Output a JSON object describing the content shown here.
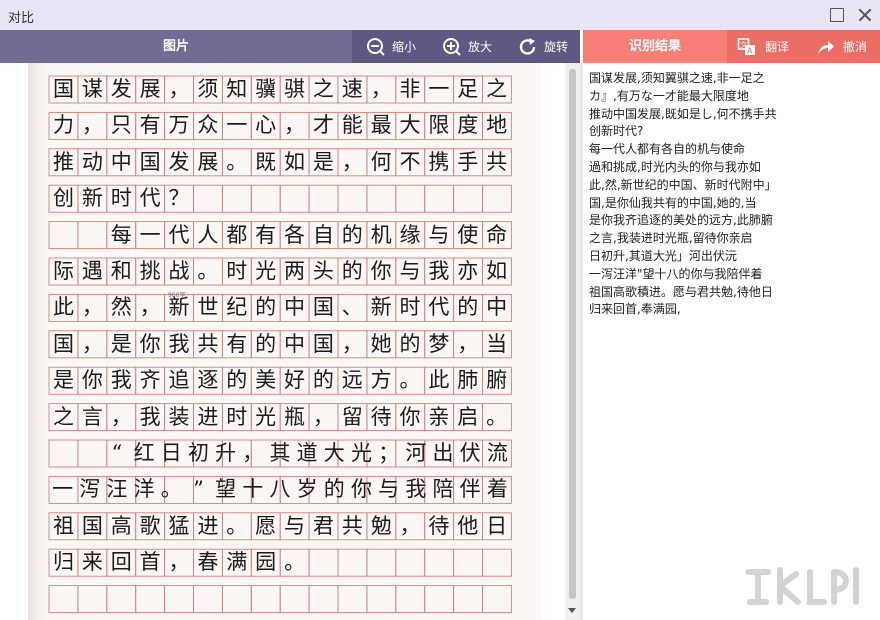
{
  "window": {
    "title": "对比"
  },
  "left_panel": {
    "title": "图片",
    "tools": [
      {
        "label": "缩小",
        "icon": "zoom-out-icon"
      },
      {
        "label": "放大",
        "icon": "zoom-in-icon"
      },
      {
        "label": "旋转",
        "icon": "rotate-icon"
      }
    ],
    "handwriting_rows": [
      "国谋发展，须知骥骐之速，非一足之",
      "力，只有万众一心，才能最大限度地",
      "推动中国发展。既如是，何不携手共",
      "创新时代？",
      "  每一代人都有各自的机缘与使命",
      "际遇和挑战。时光两头的你与我亦如",
      "此，然，新世纪的中国、新时代的中",
      "国，是你我共有的中国，她的梦，当",
      "是你我齐追逐的美好的远方。此肺腑",
      "之言，我装进时光瓶，留待你亲启。",
      "  “红日初升，其道大光；河出伏流",
      "一泻汪洋。”望十八岁的你与我陪伴着",
      "祖国高歌猛进。愿与君共勉，待他日",
      "归来回首，春满园。"
    ],
    "small_note": "960字"
  },
  "right_panel": {
    "title": "识别结果",
    "tools": [
      {
        "label": "翻译",
        "icon": "translate-icon"
      },
      {
        "label": "撤消",
        "icon": "undo-icon"
      }
    ],
    "result_lines": [
      "国谋发展,须知翼骐之速,非一足之",
      "カ』,有万な一才能最大限度地",
      "推动中国发展,既如是し,何不携手共",
      "创新时代?",
      "每一代人都有各自的机与使命",
      "過和挑成,时光内头的你与我亦如",
      "此,然,新世纪的中国、新时代附中」",
      "国,是你仙我共有的中国,她的,当",
      "是你我齐追逐的美处的远方,此肺腑",
      "之言,我装进时光瓶,留待你亲启",
      "日初升,其道大光」河出伏沅",
      "一泻汪洋\"望十八的你与我陪伴着",
      "祖国高歌積进。愿与君共勉,待他日",
      "归来回首,奉满园,"
    ]
  },
  "colors": {
    "left_bar": "#746b94",
    "left_tools_bg": "#5f5882",
    "right_bar": "#f47a73",
    "title_bar": "#e9e5f6",
    "grid_line": "#d2807e"
  }
}
